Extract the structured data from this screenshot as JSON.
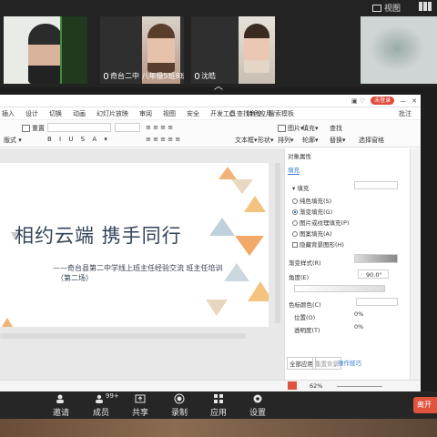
{
  "gallery": {
    "view_label": "视图",
    "participants": [
      {
        "name": ""
      },
      {
        "name": "奇台二中 八年级5班8班数..."
      },
      {
        "name": "沈皓"
      },
      {
        "name": ""
      }
    ],
    "collapse_glyph": "︿"
  },
  "wps": {
    "badge": "未登录",
    "menu": [
      "插入",
      "设计",
      "切换",
      "动画",
      "幻灯片放映",
      "审阅",
      "视图",
      "安全",
      "开发工具",
      "特色应用"
    ],
    "search": "查找命令、搜索模板",
    "right_menu": [
      "批注"
    ],
    "ribbon": {
      "layout": "版式",
      "reset": "重置",
      "textbox": "文本框",
      "shape": "形状",
      "arrange": "排列",
      "image": "图片",
      "fill": "填充",
      "outline": "轮廓",
      "find": "查找",
      "replace": "替换",
      "select_pane": "选择窗格"
    },
    "slide": {
      "title": "相约云端  携手同行",
      "subtitle": "——奇台县第二中学线上班主任经验交流 班主任培训",
      "subtitle2": "（第二场）"
    },
    "props": {
      "panel_title": "对象属性",
      "tab_fill": "填充",
      "section": "填充",
      "options": [
        "纯色填充(S)",
        "渐变填充(G)",
        "图片或纹理填充(P)",
        "图案填充(A)"
      ],
      "selected_option": 1,
      "hide_bg": "隐藏背景图形(H)",
      "gradient_style": "渐变样式(R)",
      "angle_label": "角度(E)",
      "angle_value": "90.0°",
      "color_label": "色标颜色(C)",
      "position_label": "位置(O)",
      "position_value": "0%",
      "transparency_label": "透明度(T)",
      "transparency_value": "0%",
      "apply_all": "全部应用",
      "reset_bg": "重置背景",
      "tips": "操作技巧"
    },
    "status": {
      "zoom": "62%"
    }
  },
  "toolbar": {
    "items": [
      "邀请",
      "成员",
      "共享",
      "录制",
      "应用",
      "设置"
    ],
    "member_count": "99+",
    "end_label": "离开"
  }
}
